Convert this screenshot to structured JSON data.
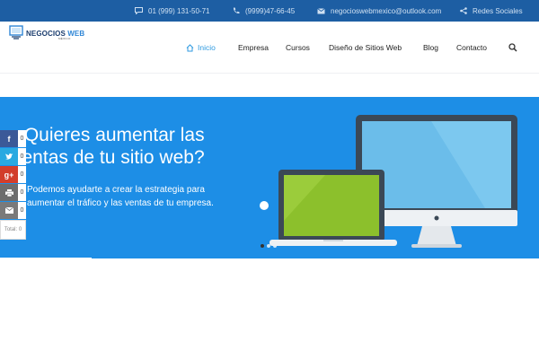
{
  "topbar": {
    "phone1": "01 (999) 131-50-71",
    "phone2": "(9999)47-66-45",
    "email": "negocioswebmexico@outlook.com",
    "social": "Redes Sociales"
  },
  "logo": {
    "word_main": "NEGOCIOS",
    "word_accent": "WEB",
    "subtitle": "MÉXICO"
  },
  "nav": {
    "items": [
      {
        "label": "Inicio"
      },
      {
        "label": "Empresa"
      },
      {
        "label": "Cursos"
      },
      {
        "label": "Diseño de Sitios Web"
      },
      {
        "label": "Blog"
      },
      {
        "label": "Contacto"
      }
    ],
    "active": "Inicio"
  },
  "hero": {
    "title": "¿Quieres aumentar las ventas de tu sitio web?",
    "subtitle": "Podemos ayudarte a crear la estrategia para aumentar el tráfico  y las ventas de tu empresa.",
    "slides": 3,
    "active_slide": 1
  },
  "share": {
    "facebook": "0",
    "twitter": "0",
    "googleplus": "0",
    "print": "0",
    "email": "0",
    "total": "Total: 0"
  },
  "colors": {
    "topbar": "#1d5ea3",
    "hero": "#1d8ee6",
    "accent": "#2f9ae0"
  },
  "icons": [
    "chat-icon",
    "phone-icon",
    "mail-icon",
    "share-icon",
    "home-icon",
    "search-icon",
    "facebook-icon",
    "twitter-icon",
    "google-plus-icon",
    "print-icon",
    "mail-share-icon"
  ]
}
